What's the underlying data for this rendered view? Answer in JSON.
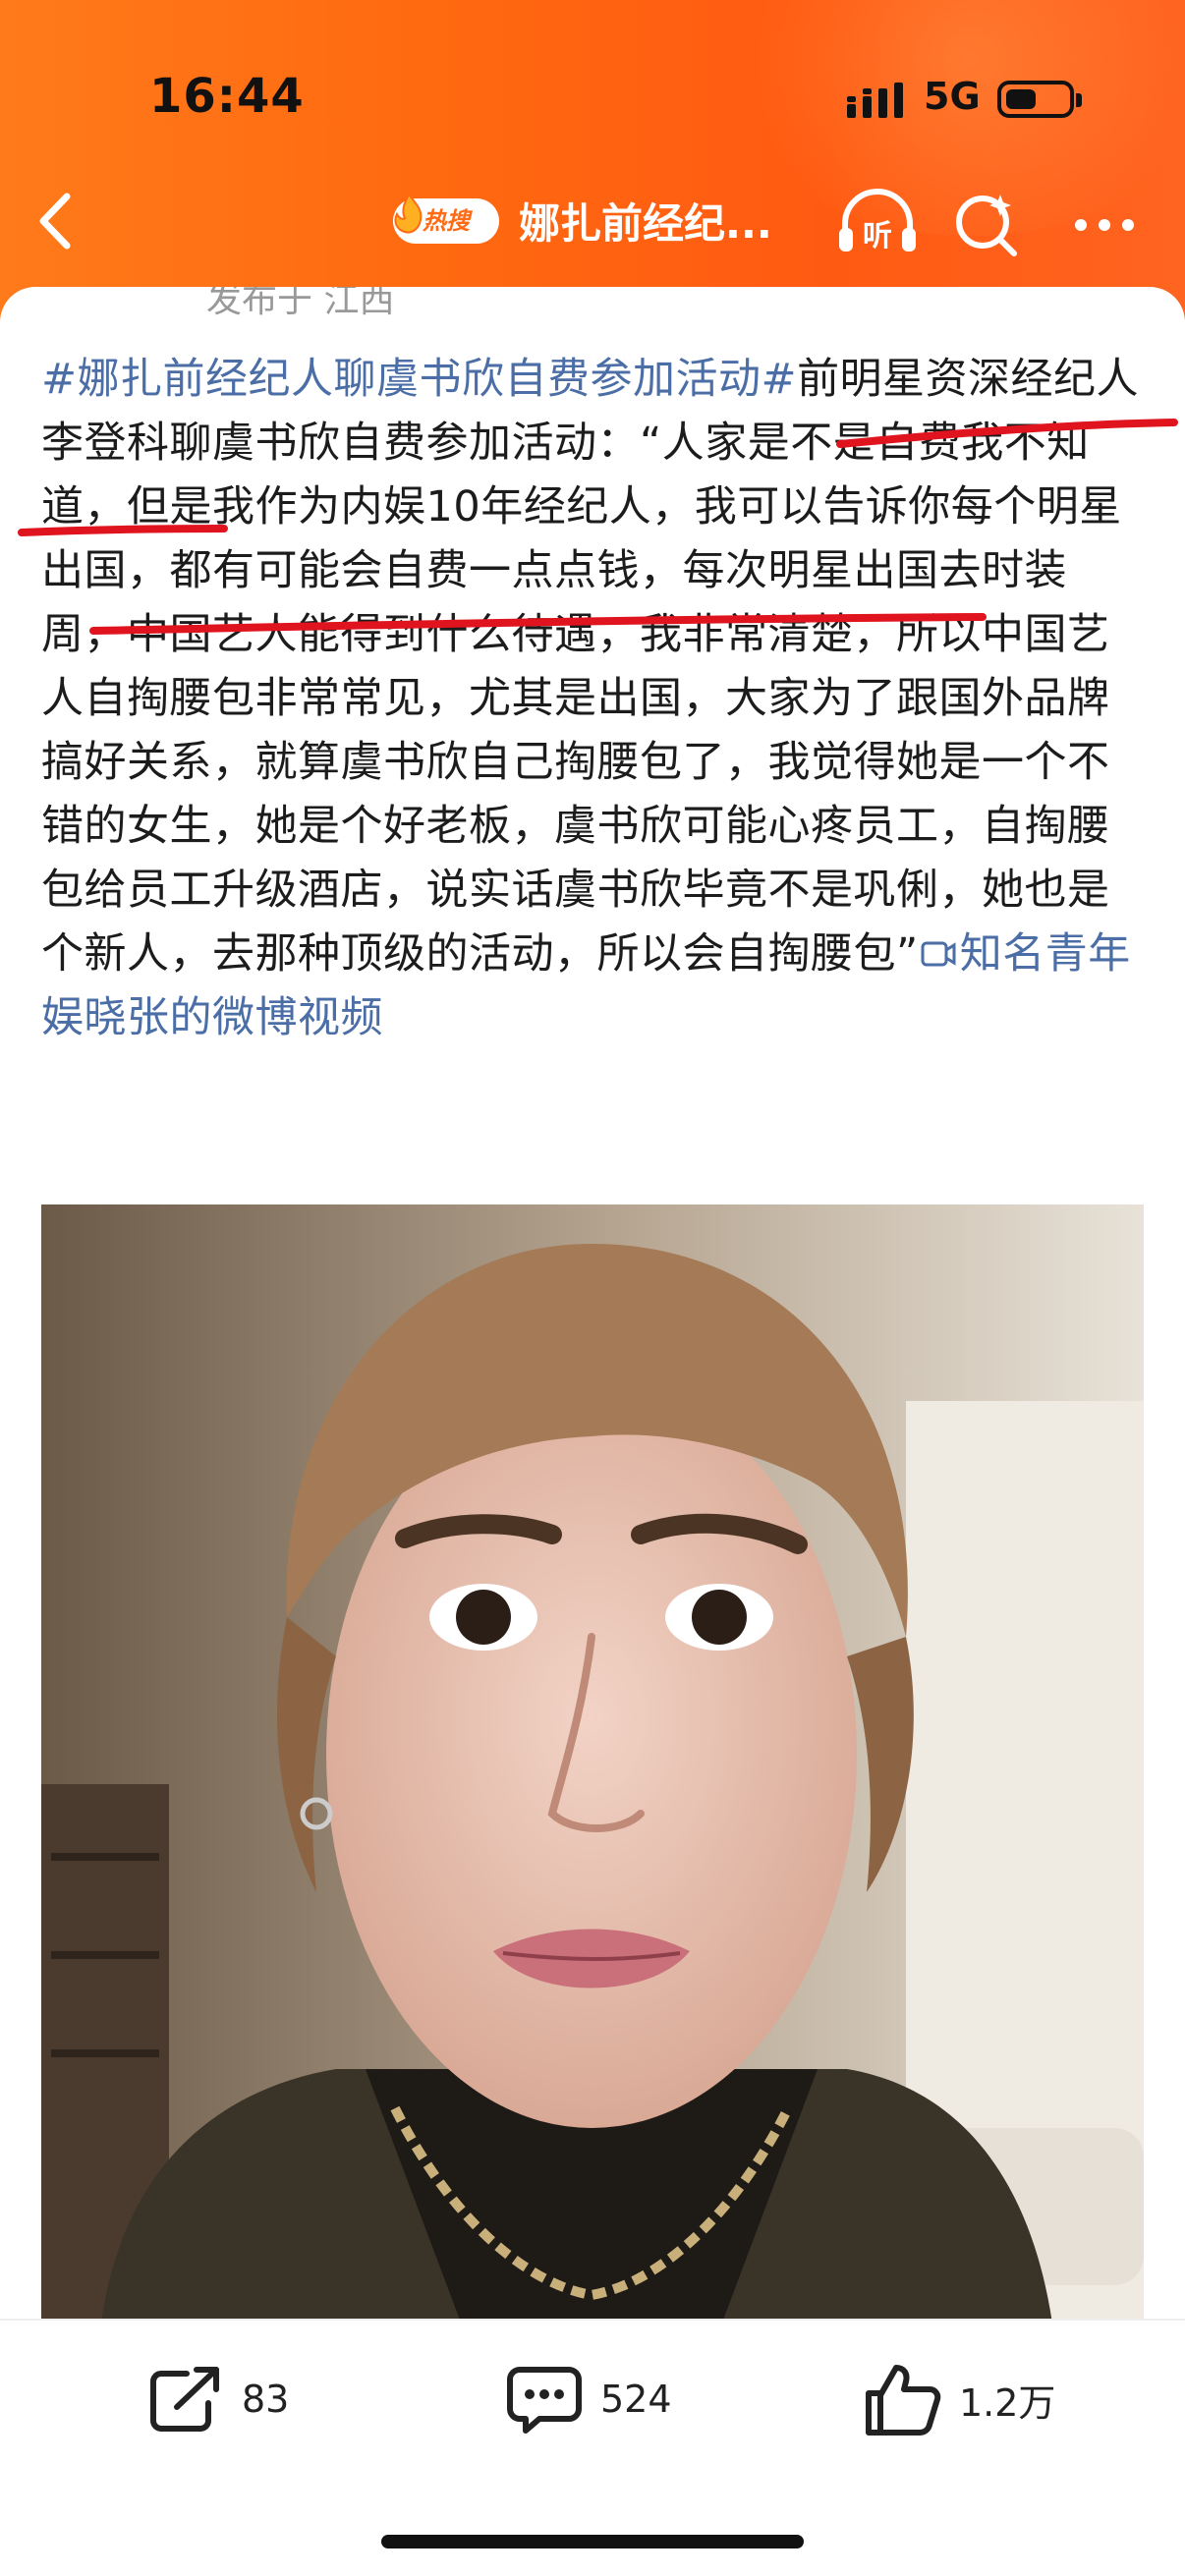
{
  "status_bar": {
    "time": "16:44",
    "network": "5G"
  },
  "nav": {
    "hot_badge": "热搜",
    "title": "娜扎前经纪...",
    "icons": [
      "back-icon",
      "listen-icon",
      "search-icon",
      "more-icon"
    ],
    "listen_label": "听"
  },
  "post": {
    "meta": "发布于 江西",
    "hashtag": "#娜扎前经纪人聊虞书欣自费参加活动#",
    "text": "前明星资深经纪人李登科聊虞书欣自费参加活动：“人家是不是自费我不知道，但是我作为内娱10年经纪人，我可以告诉你每个明星出国，都有可能会自费一点点钱，每次明星出国去时装周，中国艺人能得到什么待遇，我非常清楚，所以中国艺人自掏腰包非常常见，尤其是出国，大家为了跟国外品牌搞好关系，就算虞书欣自己掏腰包了，我觉得她是一个不错的女生，她是个好老板，虞书欣可能心疼员工，自掏腰包给员工升级酒店，说实话虞书欣毕竟不是巩俐，她也是个新人，去那种顶级的活动，所以会自掏腰包”",
    "video_link": "知名青年娱晓张的微博视频"
  },
  "actions": {
    "repost_count": "83",
    "comment_count": "524",
    "like_count": "1.2万"
  },
  "colors": {
    "accent": "#ff6a14",
    "link": "#4b6ea6",
    "annotation": "#e0141e"
  }
}
